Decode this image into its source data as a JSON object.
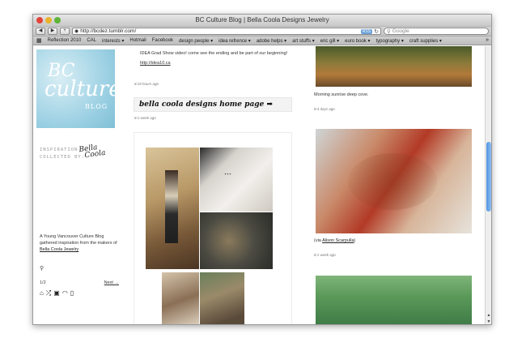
{
  "window": {
    "title": "BC Culture Blog | Bella Coola Designs Jewelry"
  },
  "toolbar": {
    "back_label": "◀",
    "forward_label": "▶",
    "add_label": "+",
    "url": "http://bcdez.tumblr.com/",
    "rss_badge": "RSS",
    "reload_label": "↻",
    "search_placeholder": "Google"
  },
  "bookmarks": [
    "Reflection 2010",
    "CAL",
    "interests ▾",
    "Hotmail",
    "Facebook",
    "design people ▾",
    "idea refrence ▾",
    "adobe helps ▾",
    "art stuffs ▾",
    "eric gill ▾",
    "euro book ▾",
    "typography ▾",
    "craft supplies ▾"
  ],
  "bookmarks_more": "»",
  "sidebar": {
    "logo_line1": "BC",
    "logo_line2": "culture",
    "logo_line3": "BLOG",
    "inspiration_line1": "INSPIRATION",
    "inspiration_line2": "COLLECTED BY:",
    "signature_line1": "Bella",
    "signature_line2": "Coola",
    "intro_text": "A Young Vancouver Culture Blog gathered inspiration from the makers of",
    "intro_link": "Bella Coola Jewelry",
    "page_indicator": "1/2",
    "next_label": "Next →",
    "icons": [
      "home-icon",
      "shuffle-icon",
      "archive-icon",
      "rss-icon",
      "mobile-icon"
    ]
  },
  "middle": {
    "post1_text": "IDEA Grad Show video! come see the ending and be part of our beginning!",
    "post1_link": "http://idea10.ca",
    "post1_time": "8:19 hours ago",
    "heading": "bella coola designs home page ➡",
    "heading_time": "8:1 week ago"
  },
  "right": {
    "caption1": "Morning sunrise deep cove.",
    "time1": "8:4 days ago",
    "via_prefix": "(via ",
    "via_link": "Alison Scarpulla",
    "via_suffix": ")",
    "time2": "8:1 week ago"
  },
  "colors": {
    "accent_scroll": "#4f92de",
    "logo_blue": "#9fd2e4"
  }
}
